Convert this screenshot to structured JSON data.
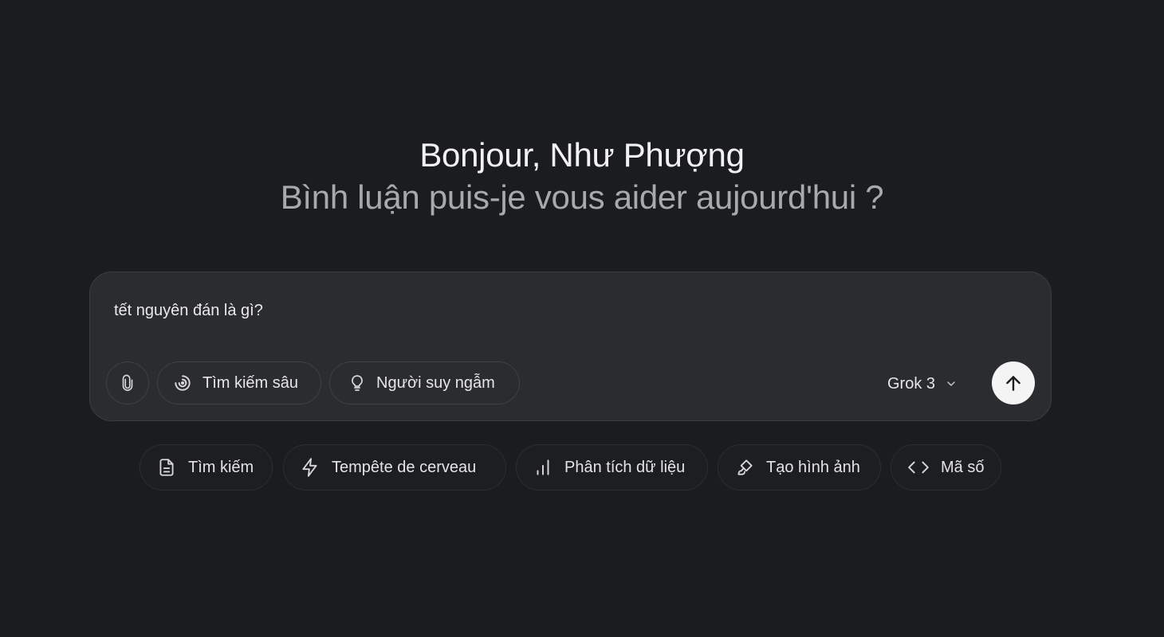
{
  "greeting": "Bonjour, Như Phượng",
  "subtitle": "Bình luận puis-je vous aider aujourd'hui ?",
  "composer": {
    "value": "tết nguyên đán là gì?",
    "deep_search_label": "Tìm kiếm sâu",
    "thinker_label": "Người suy ngẫm",
    "model": "Grok 3"
  },
  "chips": {
    "search": "Tìm kiếm",
    "brainstorm": "Tempête de cerveau",
    "analyze": "Phân tích dữ liệu",
    "image": "Tạo hình ảnh",
    "code": "Mã số"
  },
  "icons": {
    "attach": "paperclip-icon",
    "deep_search": "spiral-icon",
    "thinker": "lightbulb-icon",
    "model_dropdown": "chevron-down-icon",
    "send": "arrow-up-icon",
    "search": "document-icon",
    "brainstorm": "lightning-icon",
    "analyze": "bar-chart-icon",
    "image": "paintbrush-icon",
    "code": "code-brackets-icon"
  },
  "colors": {
    "background": "#1b1c1e",
    "composer": "#2b2c2f",
    "send_button": "#f4f4f5"
  }
}
